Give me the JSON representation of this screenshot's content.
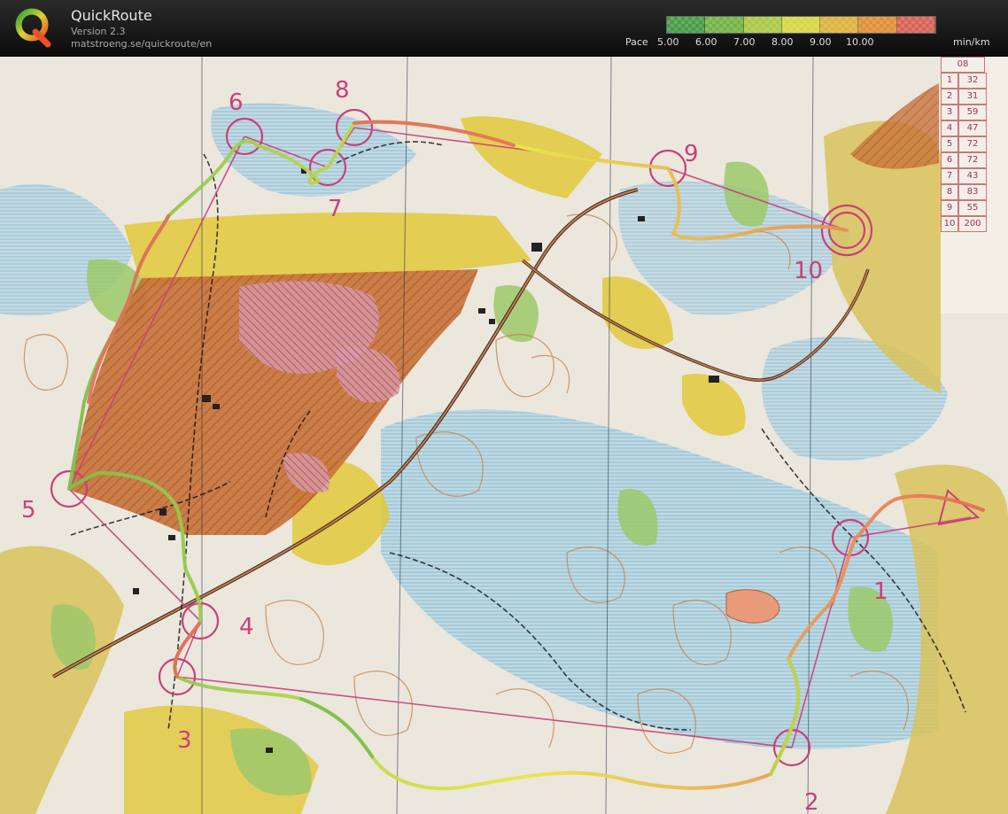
{
  "app": {
    "title": "QuickRoute",
    "version": "Version 2.3",
    "url": "matstroeng.se/quickroute/en"
  },
  "pace_legend": {
    "label": "Pace",
    "ticks": [
      "5.00",
      "6.00",
      "7.00",
      "8.00",
      "9.00",
      "10.00"
    ],
    "unit": "min/km",
    "colors": [
      "#4aa84a",
      "#7cc04a",
      "#b8d84a",
      "#e8e84a",
      "#f0c040",
      "#f09a3a",
      "#e86a5a"
    ]
  },
  "map": {
    "controls": [
      "1",
      "2",
      "3",
      "4",
      "5",
      "6",
      "7",
      "8",
      "9",
      "10"
    ],
    "split_table": {
      "header": "08",
      "rows": [
        [
          "1",
          "32"
        ],
        [
          "2",
          "31"
        ],
        [
          "3",
          "59"
        ],
        [
          "4",
          "47"
        ],
        [
          "5",
          "72"
        ],
        [
          "6",
          "72"
        ],
        [
          "7",
          "43"
        ],
        [
          "8",
          "83"
        ],
        [
          "9",
          "55"
        ],
        [
          "10",
          "200"
        ]
      ]
    },
    "colors": {
      "forest_white": "#f2f1ec",
      "open_yellow": "#e2c83a",
      "rough_open": "#d9c25a",
      "green_veg": "#9cc86a",
      "marsh_blue": "#a9cde0",
      "contour_brown": "#c97b3e",
      "control_magenta": "#c8407a",
      "restricted_orange": "#c8743a"
    }
  }
}
